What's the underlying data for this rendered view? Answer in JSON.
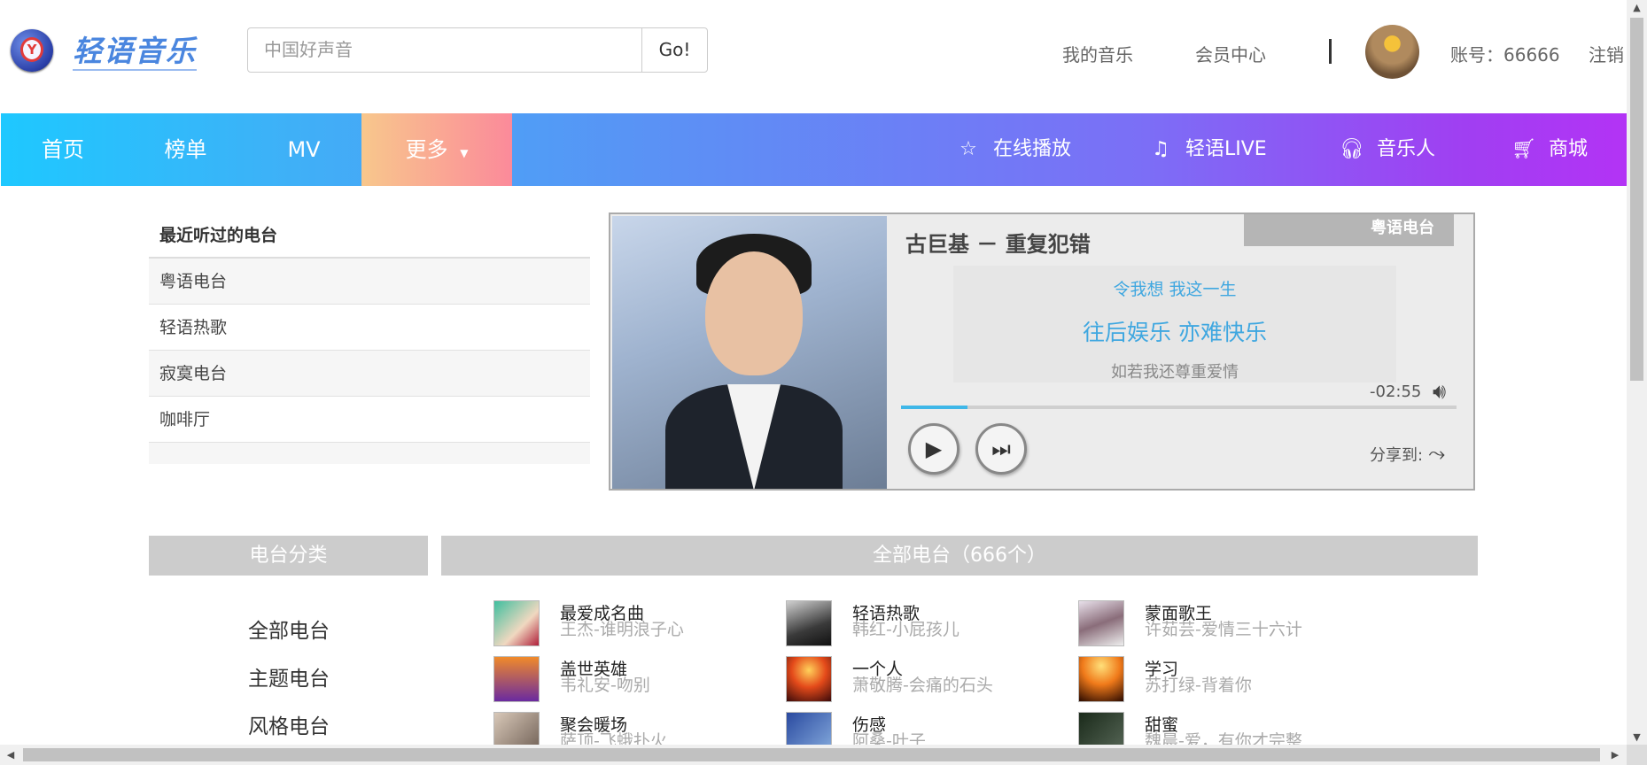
{
  "header": {
    "logo_text": "轻语音乐",
    "search_placeholder": "中国好声音",
    "search_button": "Go!",
    "links": [
      "我的音乐",
      "会员中心"
    ],
    "divider": "|",
    "account": "账号：66666",
    "logout": "注销"
  },
  "nav": {
    "items": [
      "首页",
      "榜单",
      "MV",
      "更多"
    ],
    "right_items": [
      {
        "label": "在线播放",
        "icon": "star-icon"
      },
      {
        "label": "轻语LIVE",
        "icon": "music-note-icon"
      },
      {
        "label": "音乐人",
        "icon": "headphones-icon"
      },
      {
        "label": "商城",
        "icon": "cart-icon"
      }
    ]
  },
  "recent": {
    "title": "最近听过的电台",
    "items": [
      "粤语电台",
      "轻语热歌",
      "寂寞电台",
      "咖啡厅"
    ]
  },
  "player": {
    "song_title": "古巨基 － 重复犯错",
    "station": "粤语电台",
    "lyrics": [
      "令我想 我这一生",
      "往后娱乐 亦难快乐",
      "如若我还尊重爱情"
    ],
    "time": "-02:55",
    "progress": 0.12,
    "share_label": "分享到:"
  },
  "categories": {
    "title": "电台分类",
    "items": [
      "全部电台",
      "主题电台",
      "风格电台"
    ]
  },
  "stations": {
    "title": "全部电台（666个）",
    "items": [
      {
        "name": "最爱成名曲",
        "sub": "王杰-谁明浪子心"
      },
      {
        "name": "轻语热歌",
        "sub": "韩红-小屁孩儿"
      },
      {
        "name": "蒙面歌王",
        "sub": "许茹芸-爱情三十六计"
      },
      {
        "name": "盖世英雄",
        "sub": "韦礼安-吻别"
      },
      {
        "name": "一个人",
        "sub": "萧敬腾-会痛的石头"
      },
      {
        "name": "学习",
        "sub": "苏打绿-背着你"
      },
      {
        "name": "聚会暖场",
        "sub": "萨顶-飞蛾扑火"
      },
      {
        "name": "伤感",
        "sub": "阿桑-叶子"
      },
      {
        "name": "甜蜜",
        "sub": "魏晨-爱，有你才完整"
      }
    ]
  },
  "colors": {
    "accent": "#3fa7e0",
    "nav_start": "#1ec8ff",
    "nav_end": "#b333f5",
    "panel_header": "#cccccc"
  }
}
